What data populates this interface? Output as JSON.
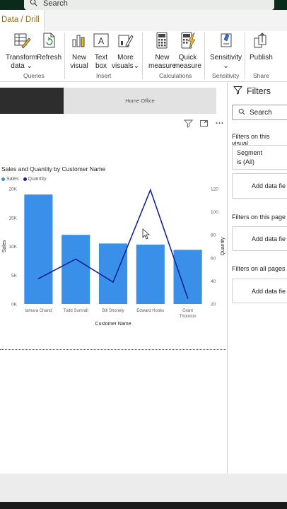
{
  "search": {
    "placeholder": "Search"
  },
  "ribbon": {
    "active_tab": "Data / Drill",
    "buttons": {
      "transform": [
        "Transform",
        "data"
      ],
      "refresh": "Refresh",
      "new_visual": [
        "New",
        "visual"
      ],
      "text_box": [
        "Text",
        "box"
      ],
      "more_visuals": [
        "More",
        "visuals"
      ],
      "new_measure": [
        "New",
        "measure"
      ],
      "quick_measure": [
        "Quick",
        "measure"
      ],
      "sensitivity": "Sensitivity",
      "publish": "Publish"
    },
    "groups": {
      "queries": "Queries",
      "insert": "Insert",
      "calculations": "Calculations",
      "sensitivity": "Sensitivity",
      "share": "Share"
    }
  },
  "canvas": {
    "banner_text": "Home Office"
  },
  "chart_data": {
    "type": "bar",
    "title": "Sales and Quantity by Customer Name",
    "categories": [
      "Iamara Chand",
      "Todd Sumrall",
      "Bill Shonely",
      "Edward Hooks",
      "Grant Thornton"
    ],
    "category_lines": [
      [
        "Iamara Chand"
      ],
      [
        "Todd Sumrall"
      ],
      [
        "Bill Shonely"
      ],
      [
        "Edward Hooks"
      ],
      [
        "Grant",
        "Thornton"
      ]
    ],
    "series": [
      {
        "name": "Sales",
        "type": "bar",
        "axis": "left",
        "values": [
          19000,
          12000,
          10500,
          10300,
          9400
        ]
      },
      {
        "name": "Quantity",
        "type": "line",
        "axis": "right",
        "values": [
          42,
          59,
          39,
          119,
          25
        ]
      }
    ],
    "xlabel": "Customer Name",
    "ylabel": "Sales",
    "y2label": "Quantity",
    "ylim": [
      0,
      20000
    ],
    "y2lim": [
      20,
      120
    ],
    "yticks": [
      "0K",
      "5K",
      "10K",
      "15K",
      "20K"
    ],
    "y2ticks": [
      "20",
      "40",
      "60",
      "80",
      "100",
      "120"
    ],
    "colors": {
      "Sales": "#3a8fe8",
      "Quantity": "#12239e"
    },
    "legend": "top-left",
    "grid": false
  },
  "filters": {
    "title": "Filters",
    "search_label": "Search",
    "on_visual": "Filters on this visual",
    "segment_field": "Segment",
    "segment_value": "is (All)",
    "add_data": "Add data fie",
    "on_page": "Filters on this page",
    "on_all_pages": "Filters on all pages"
  }
}
